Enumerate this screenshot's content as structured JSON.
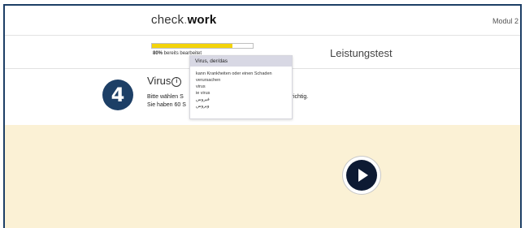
{
  "app": {
    "logo_part1": "check",
    "logo_dot": ".",
    "logo_part2": "work",
    "module": "Modul 2"
  },
  "progress": {
    "percent": 80,
    "percent_text": "80%",
    "label_rest": " bereits bearbeitet"
  },
  "test_title": "Leistungstest",
  "step_number": "4",
  "word": {
    "title": "Virus",
    "info_icon": "info-icon"
  },
  "instructions": {
    "line1_start": "Bitte wählen S",
    "line1_end": "vort richtig.",
    "line2_start": "Sie haben 60 S"
  },
  "dropdown": {
    "selected": "Virus, der/das",
    "options": [
      "kann Krankheiten oder einen Schaden verursachen",
      "virus",
      "ie virus",
      "فيروس",
      "ویروس"
    ]
  },
  "video": {
    "play_icon": "play-icon",
    "background": "#fbf1d5"
  },
  "colors": {
    "accent": "#1d3f66",
    "progress": "#f3d40a"
  }
}
